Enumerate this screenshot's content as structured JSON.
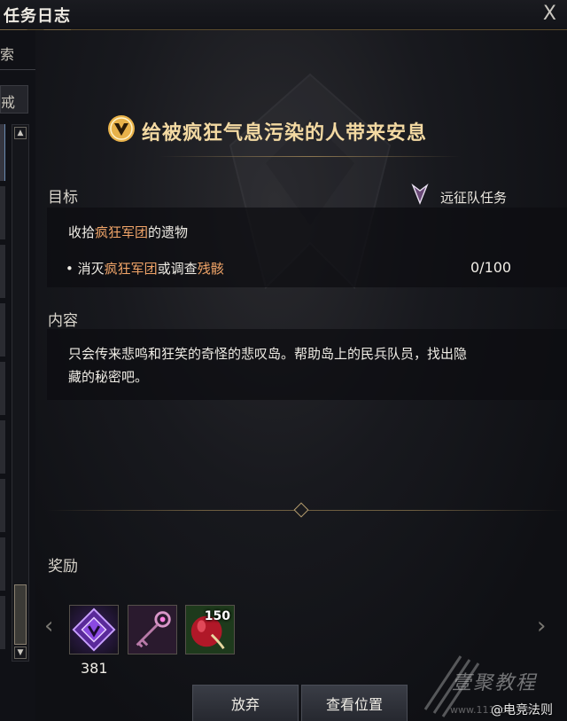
{
  "window": {
    "title": "任务日志",
    "close_label": "X"
  },
  "sidebar": {
    "tab_label": "索",
    "search_label": "戒",
    "scroll_up": "▲",
    "scroll_down": "▼"
  },
  "quest": {
    "title": "给被疯狂气息污染的人带来安息",
    "objective_label": "目标",
    "type_label": "远征队任务",
    "objective_main": {
      "prefix": "收拾",
      "highlight": "疯狂军团",
      "suffix": "的遗物"
    },
    "objective_task": {
      "bullet": "•",
      "part1": "消灭",
      "highlight1": "疯狂军团",
      "part2": "或调查",
      "highlight2": "残骸",
      "progress": "0/100"
    },
    "content_label": "内容",
    "content_lines": [
      "只会传来悲鸣和狂笑的奇怪的悲叹岛。帮助岛上的民兵队员，找出隐",
      "藏的秘密吧。"
    ]
  },
  "rewards": {
    "label": "奖励",
    "prev_arrow": "‹",
    "next_arrow": "›",
    "items": [
      {
        "icon": "purple-crystal-icon",
        "count": "381"
      },
      {
        "icon": "key-icon",
        "count": ""
      },
      {
        "icon": "red-fruit-icon",
        "count": "150"
      }
    ]
  },
  "buttons": {
    "abandon": "放弃",
    "view_location": "查看位置"
  },
  "watermark": {
    "text": "壹聚教程",
    "url": "www.111com.net",
    "channel": "@电竞法则"
  },
  "colors": {
    "highlight": "#f0a468",
    "title_gold": "#f3d9a2",
    "accent_border": "#5a4a2c"
  }
}
